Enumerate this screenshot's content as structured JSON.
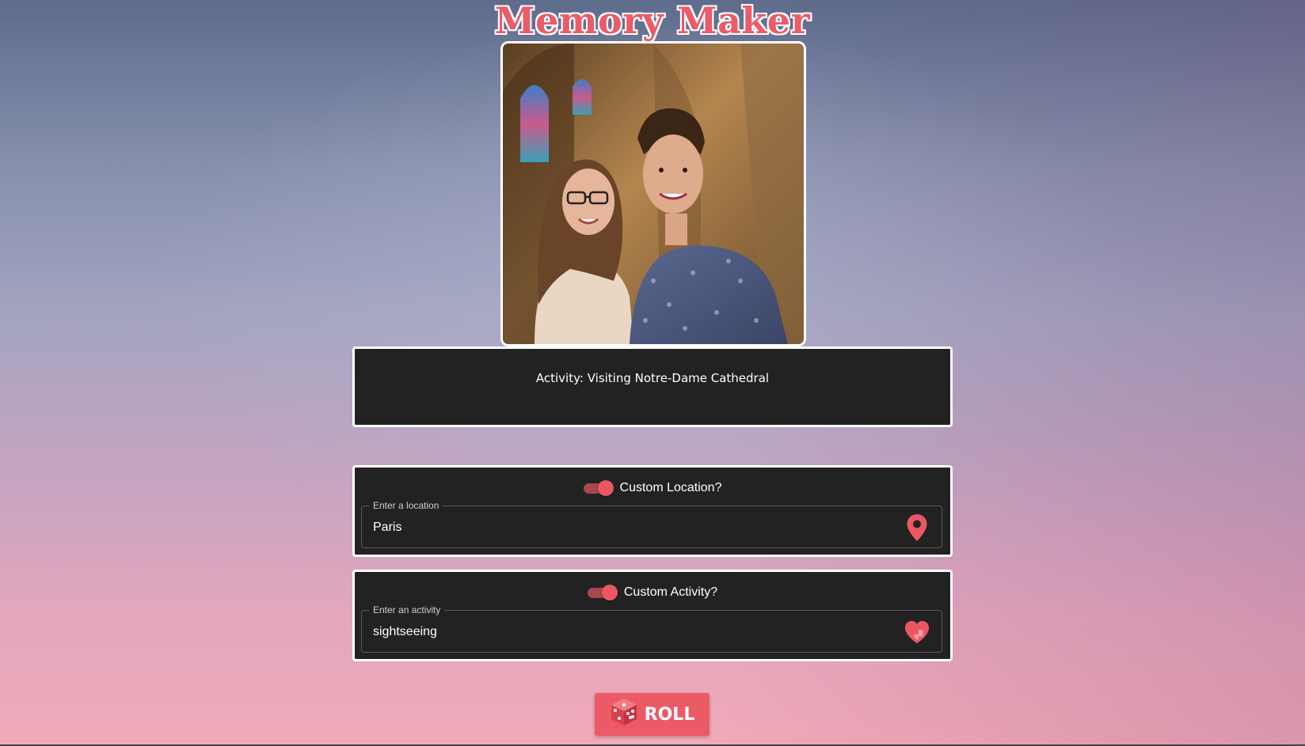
{
  "app": {
    "title": "Memory Maker"
  },
  "photo": {
    "description_icon": "couple-photo"
  },
  "activity_result": {
    "text": "Activity: Visiting Notre-Dame Cathedral"
  },
  "location_panel": {
    "toggle_label": "Custom Location?",
    "toggle_on": true,
    "field_label": "Enter a location",
    "value": "Paris",
    "icon": "location-pin-icon"
  },
  "activity_panel": {
    "toggle_label": "Custom Activity?",
    "toggle_on": true,
    "field_label": "Enter an activity",
    "value": "sightseeing",
    "icon": "heart-icon"
  },
  "roll_button": {
    "label": "ROLL",
    "icon": "dice-icon"
  },
  "colors": {
    "accent": "#ec5a66",
    "panel_bg": "#222222",
    "border": "#ffffff"
  }
}
